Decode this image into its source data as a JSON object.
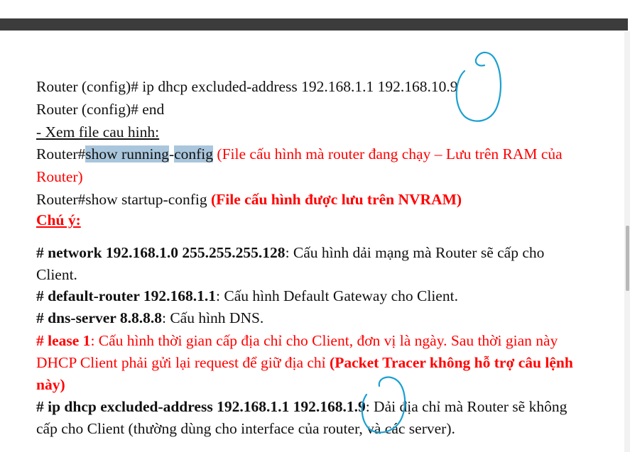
{
  "lines": {
    "l1": "Router (config)# ip dhcp excluded-address 192.168.1.1 192.168.10.9",
    "l2": "Router (config)# end",
    "l3": "- Xem file cau hinh:",
    "l4_prefix": "Router#",
    "l4_hl1": "show running",
    "l4_dash": "-",
    "l4_hl2": "config",
    "l4_note": " (File cấu hình mà router đang chạy – Lưu trên RAM của",
    "l5": "Router)",
    "l6_cmd": "Router#show startup-config ",
    "l6_note": "(File cấu hình được lưu trên NVRAM)",
    "l7": "Chú ý:",
    "l8_bold": "# network 192.168.1.0 255.255.255.128",
    "l8_text": ": Cấu hình dải mạng mà Router sẽ cấp cho",
    "l9": "Client.",
    "l10_bold": "# default-router 192.168.1.1",
    "l10_text": ": Cấu hình Default Gateway cho Client.",
    "l11_bold": "# dns-server 8.8.8.8",
    "l11_text": ": Cấu hình DNS.",
    "l12_bold": "# lease 1",
    "l12_text": ": Cấu hình thời gian cấp địa chỉ cho Client, đơn vị là ngày. Sau thời gian này",
    "l13_text": "DHCP Client phải gửi lại request để giữ địa chỉ ",
    "l13_bold": "(Packet Tracer không hỗ trợ câu lệnh",
    "l14_bold": "này)",
    "l15_bold": "# ip dhcp excluded-address 192.168.1.1 192.168.1.9",
    "l15_text": ": Dải địa chỉ mà Router sẽ không",
    "l16": "cấp cho Client (thường dùng cho interface của router, và các server)."
  },
  "colors": {
    "red": "#ff0000",
    "highlight": "#a9c6dc",
    "annotation": "#1aa0d0"
  }
}
